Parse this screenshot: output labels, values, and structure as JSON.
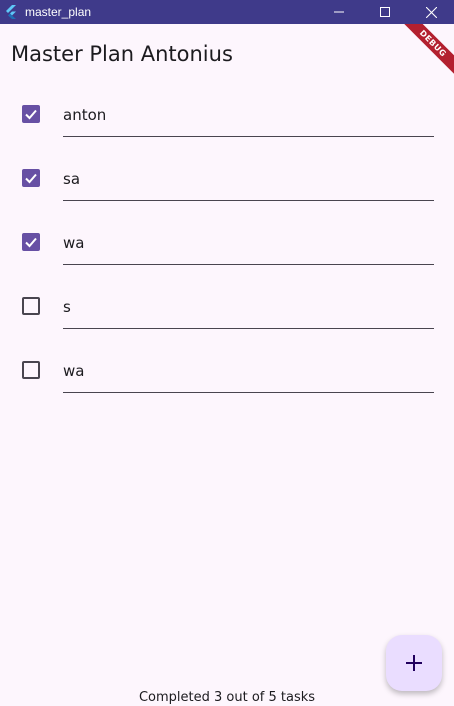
{
  "window": {
    "title": "master_plan",
    "icon": "flutter-logo-icon",
    "controls": [
      "minimize-icon",
      "maximize-icon",
      "close-icon"
    ]
  },
  "debug_banner": "DEBUG",
  "header": {
    "title": "Master Plan Antonius"
  },
  "tasks": [
    {
      "text": "anton",
      "completed": true
    },
    {
      "text": "sa",
      "completed": true
    },
    {
      "text": "wa",
      "completed": true
    },
    {
      "text": "s",
      "completed": false
    },
    {
      "text": "wa",
      "completed": false
    }
  ],
  "fab": {
    "icon": "add-icon"
  },
  "footer": {
    "status": "Completed 3 out of 5 tasks"
  },
  "colors": {
    "titlebar": "#3f3a8a",
    "background": "#fdf6fd",
    "accent": "#6750a4",
    "fab": "#eaddff",
    "debug": "#b3202f"
  }
}
